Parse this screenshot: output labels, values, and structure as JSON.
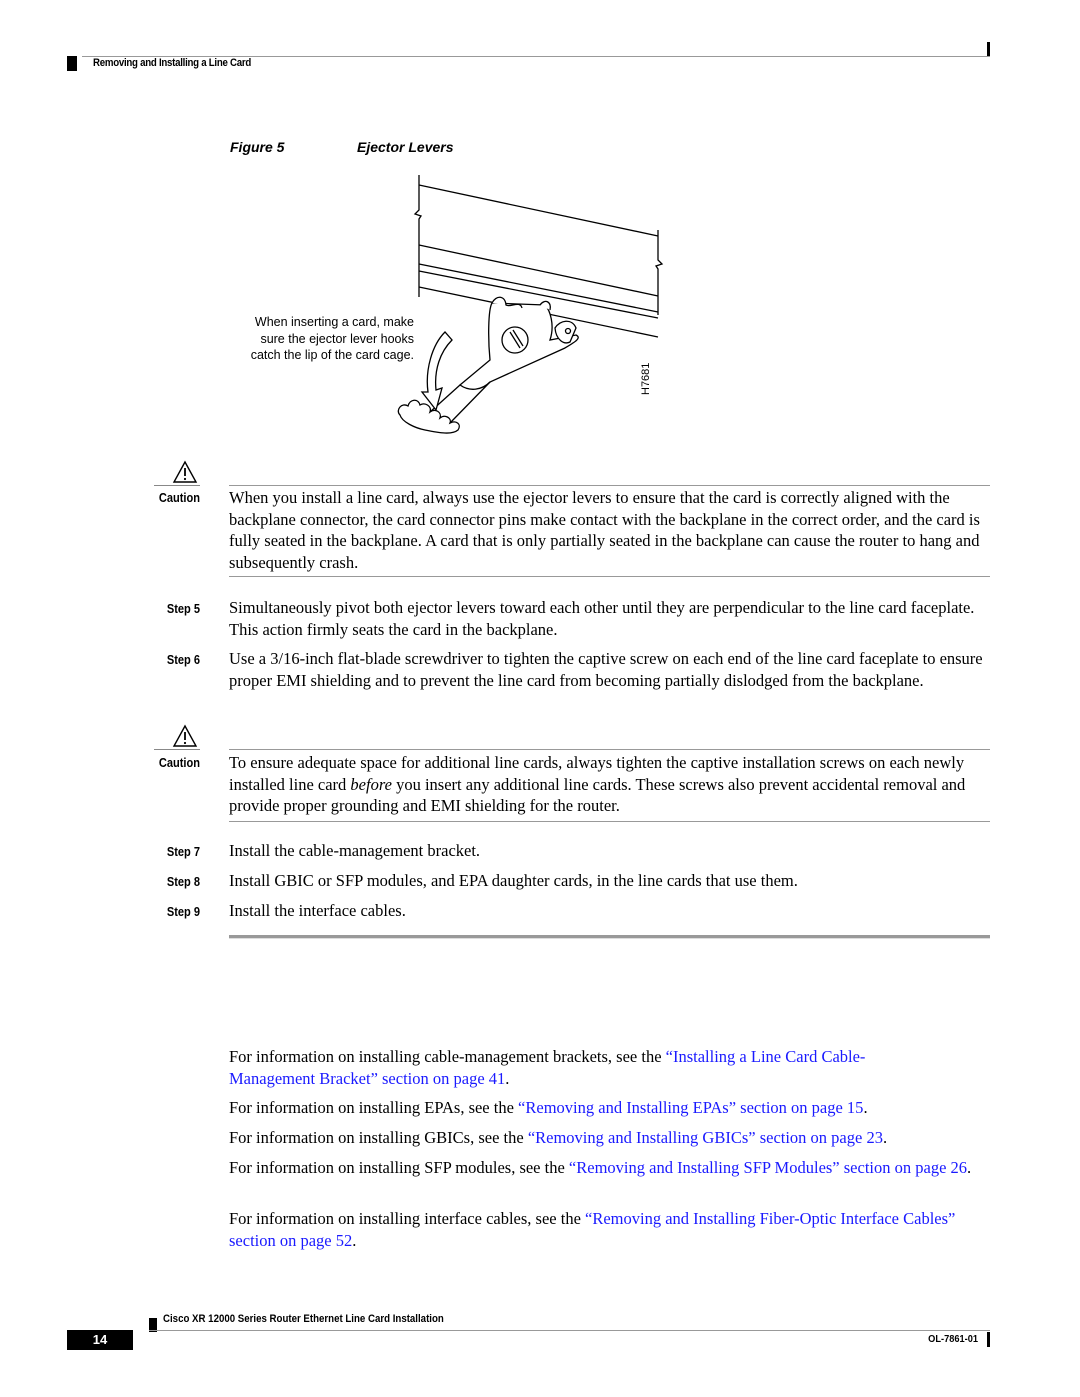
{
  "header": {
    "section_title": "Removing and Installing a Line Card"
  },
  "figure": {
    "label": "Figure 5",
    "title": "Ejector Levers",
    "callout_lines": [
      "When inserting a card, make",
      "sure the ejector lever hooks",
      "catch the lip of the card cage."
    ],
    "art_id": "H7681"
  },
  "cautions": [
    {
      "label": "Caution",
      "icon": "warning-triangle-icon",
      "text": "When you install a line card, always use the ejector levers to ensure that the card is correctly aligned with the backplane connector, the card connector pins make contact with the backplane in the correct order, and the card is fully seated in the backplane. A card that is only partially seated in the backplane can cause the router to hang and subsequently crash."
    },
    {
      "label": "Caution",
      "icon": "warning-triangle-icon",
      "text_before": "To ensure adequate space for additional line cards, always tighten the captive installation screws on each newly installed line card ",
      "text_italic": "before",
      "text_after": " you insert any additional line cards. These screws also prevent accidental removal and provide proper grounding and EMI shielding for the router."
    }
  ],
  "steps": [
    {
      "label": "Step 5",
      "text": "Simultaneously pivot both ejector levers toward each other until they are perpendicular to the line card faceplate. This action firmly seats the card in the backplane."
    },
    {
      "label": "Step 6",
      "text": "Use a 3/16-inch flat-blade screwdriver to tighten the captive screw on each end of the line card faceplate to ensure proper EMI shielding and to prevent the line card from becoming partially dislodged from the backplane."
    },
    {
      "label": "Step 7",
      "text": "Install the cable-management bracket."
    },
    {
      "label": "Step 8",
      "text": "Install GBIC or SFP modules, and EPA daughter cards, in the line cards that use them."
    },
    {
      "label": "Step 9",
      "text": "Install the interface cables."
    }
  ],
  "references": [
    {
      "prefix": "For information on installing cable-management brackets, see the ",
      "link": "“Installing a Line Card Cable-Management Bracket” section on page 41",
      "suffix": "."
    },
    {
      "prefix": "For information on installing EPAs, see the ",
      "link": "“Removing and Installing EPAs” section on page 15",
      "suffix": "."
    },
    {
      "prefix": "For information on installing GBICs, see the ",
      "link": "“Removing and Installing GBICs” section on page 23",
      "suffix": "."
    },
    {
      "prefix": "For information on installing SFP modules, see the ",
      "link": "“Removing and Installing SFP Modules” section on page 26",
      "suffix": "."
    },
    {
      "prefix": "For information on installing interface cables, see the ",
      "link": "“Removing and Installing Fiber-Optic Interface Cables” section on page 52",
      "suffix": "."
    }
  ],
  "footer": {
    "doc_title": "Cisco XR 12000 Series Router Ethernet Line Card Installation",
    "page_number": "14",
    "doc_id": "OL-7861-01"
  },
  "colors": {
    "link": "#1a1aff",
    "rule": "#999999"
  }
}
